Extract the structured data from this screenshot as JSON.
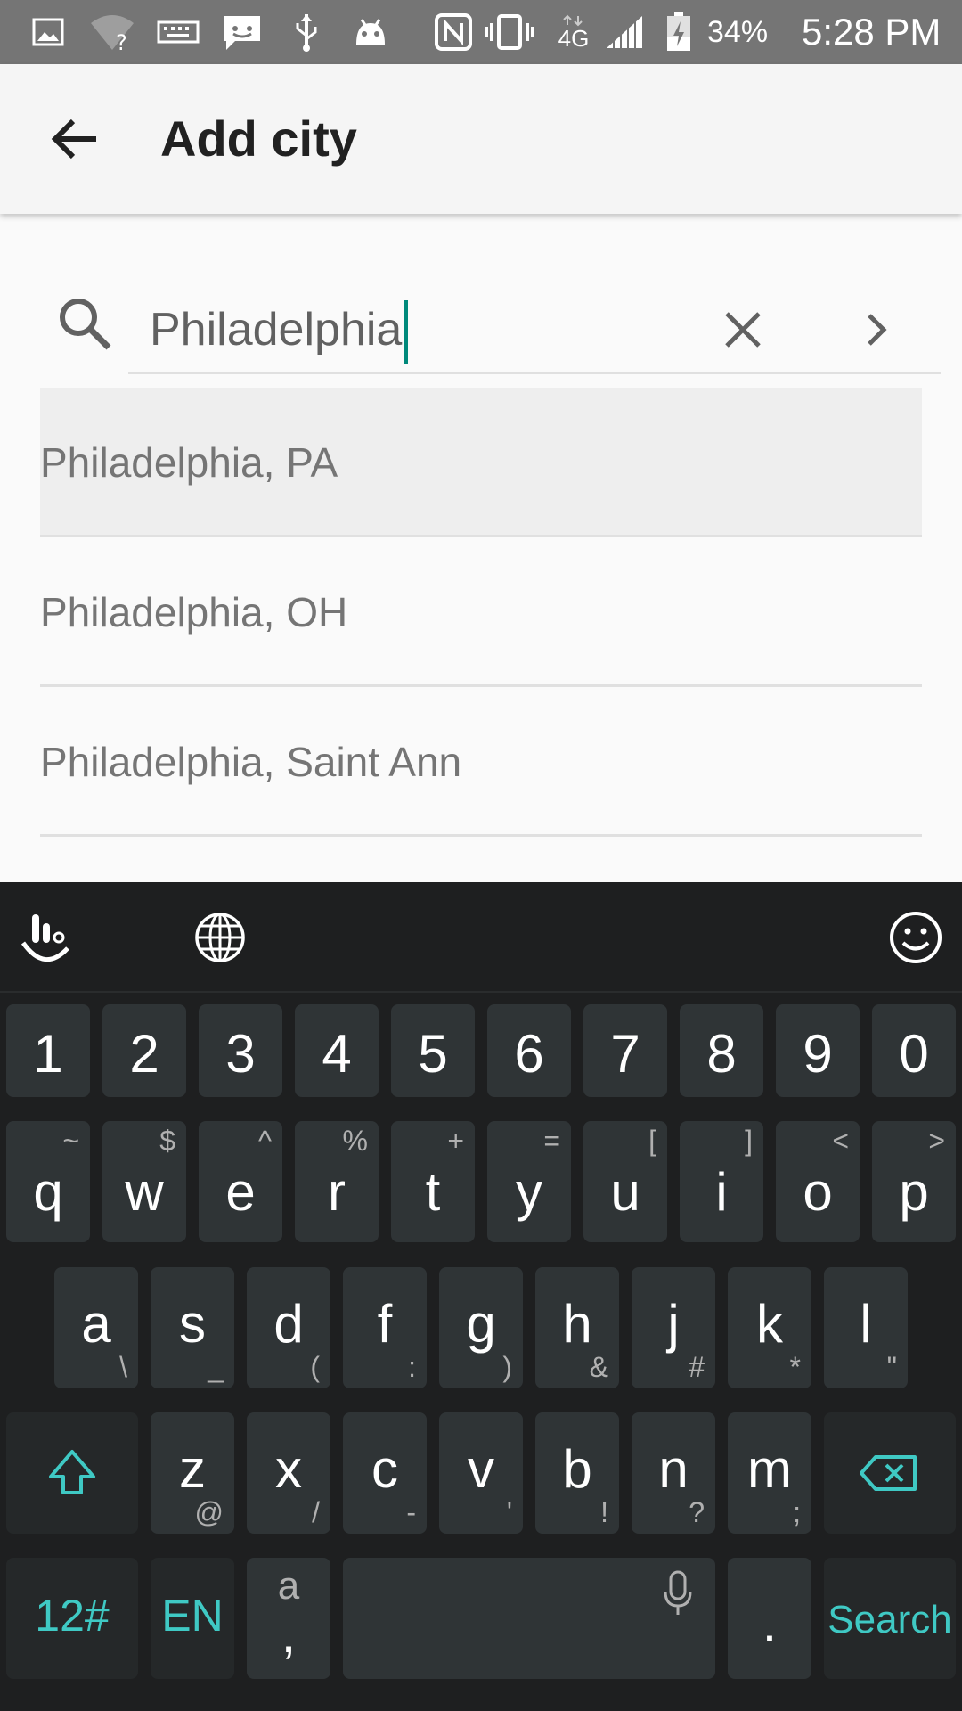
{
  "status_bar": {
    "battery": "34%",
    "network": "4G",
    "time": "5:28 PM"
  },
  "app_bar": {
    "title": "Add city"
  },
  "search": {
    "value": "Philadelphia"
  },
  "results": [
    {
      "label": "Philadelphia, PA",
      "selected": true
    },
    {
      "label": "Philadelphia, OH",
      "selected": false
    },
    {
      "label": "Philadelphia, Saint Ann",
      "selected": false
    }
  ],
  "keyboard": {
    "number_row": [
      "1",
      "2",
      "3",
      "4",
      "5",
      "6",
      "7",
      "8",
      "9",
      "0"
    ],
    "row1": [
      {
        "main": "q",
        "sub": "~"
      },
      {
        "main": "w",
        "sub": "$"
      },
      {
        "main": "e",
        "sub": "^"
      },
      {
        "main": "r",
        "sub": "%"
      },
      {
        "main": "t",
        "sub": "+"
      },
      {
        "main": "y",
        "sub": "="
      },
      {
        "main": "u",
        "sub": "["
      },
      {
        "main": "i",
        "sub": "]"
      },
      {
        "main": "o",
        "sub": "<"
      },
      {
        "main": "p",
        "sub": ">"
      }
    ],
    "row2": [
      {
        "main": "a",
        "sub": "\\"
      },
      {
        "main": "s",
        "sub": "_"
      },
      {
        "main": "d",
        "sub": "("
      },
      {
        "main": "f",
        "sub": ":"
      },
      {
        "main": "g",
        "sub": ")"
      },
      {
        "main": "h",
        "sub": "&"
      },
      {
        "main": "j",
        "sub": "#"
      },
      {
        "main": "k",
        "sub": "*"
      },
      {
        "main": "l",
        "sub": "\""
      }
    ],
    "row3": [
      {
        "main": "z",
        "sub": "@"
      },
      {
        "main": "x",
        "sub": "/"
      },
      {
        "main": "c",
        "sub": "-"
      },
      {
        "main": "v",
        "sub": "'"
      },
      {
        "main": "b",
        "sub": "!"
      },
      {
        "main": "n",
        "sub": "?"
      },
      {
        "main": "m",
        "sub": ";"
      }
    ],
    "symbols_label": "12#",
    "language_label": "EN",
    "comma_key_top": "a",
    "comma_key_bottom": ",",
    "period_label": ".",
    "action_label": "Search"
  },
  "colors": {
    "accent": "#00897b",
    "keyboard_accent": "#3fc9c4",
    "status_bar": "#757575",
    "keyboard_bg": "#1e1f20",
    "key_bg": "#2f3436"
  }
}
